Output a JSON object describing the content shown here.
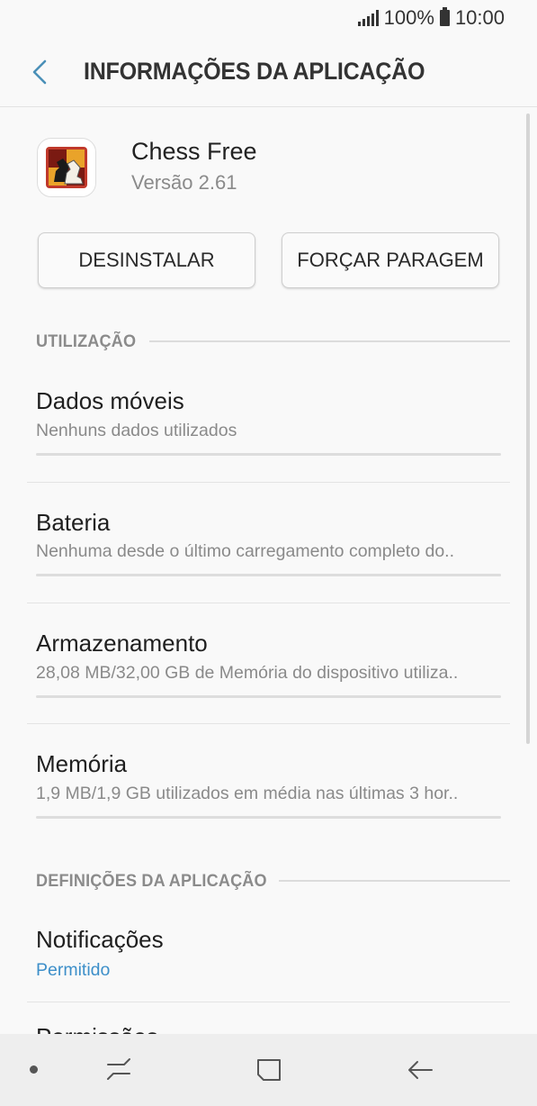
{
  "status": {
    "battery_percent": "100%",
    "time": "10:00"
  },
  "header": {
    "title": "INFORMAÇÕES DA APLICAÇÃO"
  },
  "app": {
    "name": "Chess Free",
    "version": "Versão 2.61"
  },
  "buttons": {
    "uninstall": "DESINSTALAR",
    "force_stop": "FORÇAR PARAGEM"
  },
  "usage": {
    "header": "UTILIZAÇÃO",
    "items": [
      {
        "title": "Dados móveis",
        "subtitle": "Nenhuns dados utilizados"
      },
      {
        "title": "Bateria",
        "subtitle": "Nenhuma desde o último carregamento completo do.."
      },
      {
        "title": "Armazenamento",
        "subtitle": "28,08 MB/32,00 GB de Memória do dispositivo utiliza.."
      },
      {
        "title": "Memória",
        "subtitle": "1,9 MB/1,9 GB utilizados em média nas últimas 3 hor.."
      }
    ]
  },
  "app_settings": {
    "header": "DEFINIÇÕES DA APLICAÇÃO",
    "items": [
      {
        "title": "Notificações",
        "subtitle": "Permitido"
      },
      {
        "title": "Permissões"
      }
    ]
  },
  "colors": {
    "accent": "#3d8fc9",
    "back_icon": "#4a90b8"
  },
  "icons": {
    "back": "back-arrow-icon",
    "recents": "recents-icon",
    "home": "home-icon",
    "nav_back": "nav-back-icon"
  }
}
